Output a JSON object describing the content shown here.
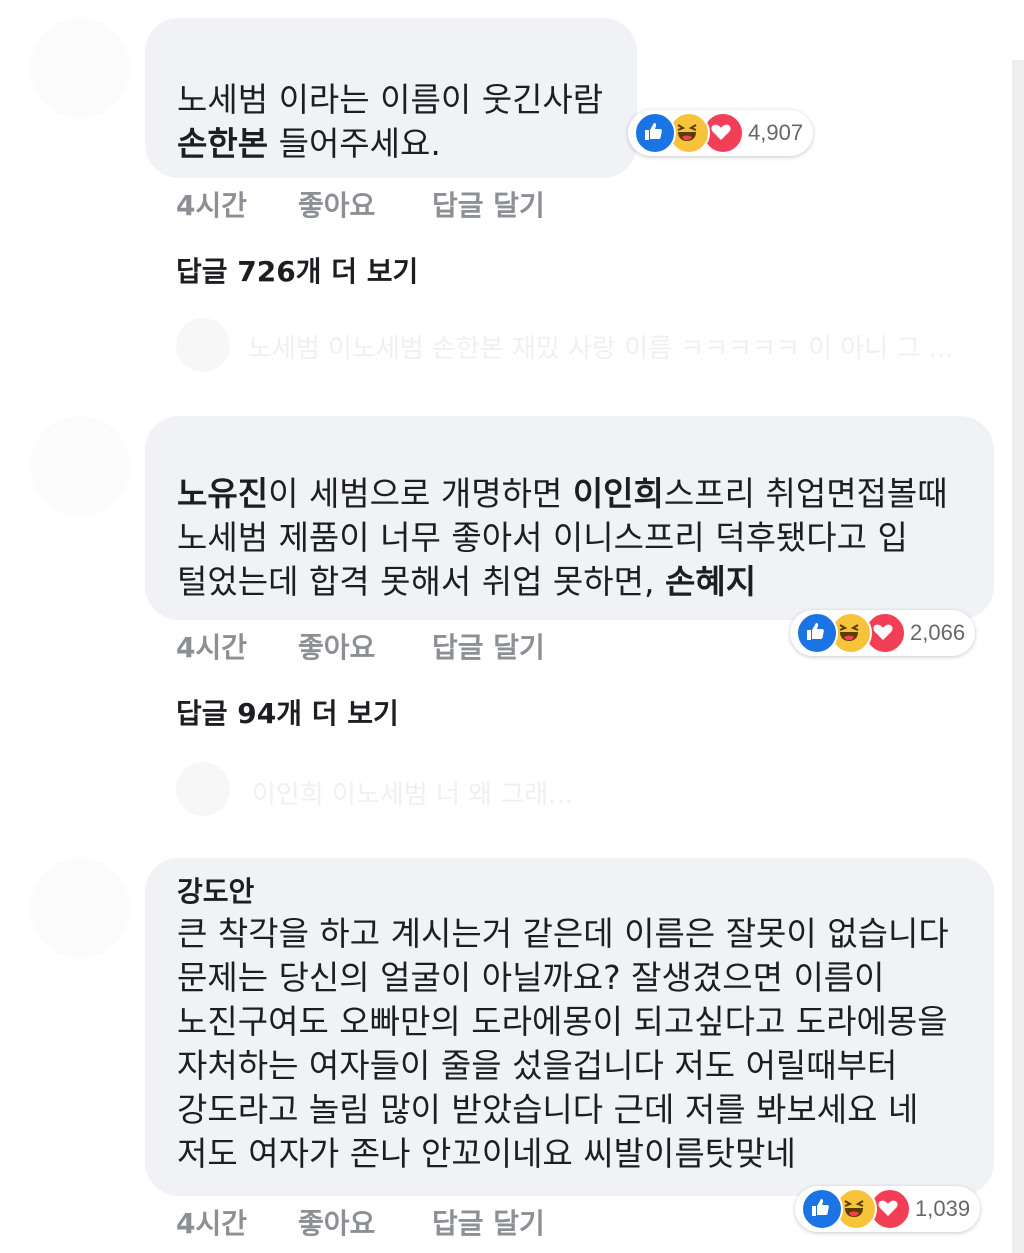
{
  "comments": [
    {
      "lines": [
        [
          {
            "t": "노세범 이라는 이름이 웃긴사람",
            "b": false
          }
        ],
        [
          {
            "t": "손한본",
            "b": true
          },
          {
            "t": " 들어주세요.",
            "b": false
          }
        ]
      ],
      "time": "4시간",
      "like": "좋아요",
      "reply": "답글 달기",
      "reaction_count": "4,907",
      "more_replies": "답글 726개 더 보기",
      "preview": "노세범 이노세범 손한본 재밌 사랑 이름 ㅋㅋㅋㅋㅋ 이 아니 그 ..."
    },
    {
      "lines": [
        [
          {
            "t": "노유진",
            "b": true
          },
          {
            "t": "이 세범으로 개명하면 ",
            "b": false
          },
          {
            "t": "이인희",
            "b": true
          },
          {
            "t": "스프리 취업면접볼때",
            "b": false
          }
        ],
        [
          {
            "t": "노세범 제품이 너무 좋아서 이니스프리 덕후됐다고 입",
            "b": false
          }
        ],
        [
          {
            "t": "털었는데 합격 못해서 취업 못하면, ",
            "b": false
          },
          {
            "t": "손혜지",
            "b": true
          }
        ]
      ],
      "time": "4시간",
      "like": "좋아요",
      "reply": "답글 달기",
      "reaction_count": "2,066",
      "more_replies": "답글 94개 더 보기",
      "preview": "이인희 이노세범 너 왜 그래..."
    },
    {
      "author": "강도안",
      "lines": [
        [
          {
            "t": "큰 착각을 하고 계시는거 같은데 이름은 잘못이 없습니다",
            "b": false
          }
        ],
        [
          {
            "t": "문제는 당신의 얼굴이 아닐까요? 잘생겼으면 이름이",
            "b": false
          }
        ],
        [
          {
            "t": "노진구여도 오빠만의 도라에몽이 되고싶다고 도라에몽을",
            "b": false
          }
        ],
        [
          {
            "t": "자처하는 여자들이 줄을 섰을겁니다 저도 어릴때부터",
            "b": false
          }
        ],
        [
          {
            "t": "강도라고 놀림 많이 받았습니다 근데 저를 봐보세요 네",
            "b": false
          }
        ],
        [
          {
            "t": "저도 여자가 존나 안꼬이네요 씨발이름탓맞네",
            "b": false
          }
        ]
      ],
      "time": "4시간",
      "like": "좋아요",
      "reply": "답글 달기",
      "reaction_count": "1,039"
    }
  ],
  "icons": {
    "like": "like-reaction-icon",
    "haha": "haha-reaction-icon",
    "love": "love-reaction-icon"
  },
  "colors": {
    "bubble": "#f1f2f6",
    "meta": "#8c8f94",
    "like": "#1b74e4",
    "haha": "#f7c33a",
    "love": "#f33e58"
  }
}
